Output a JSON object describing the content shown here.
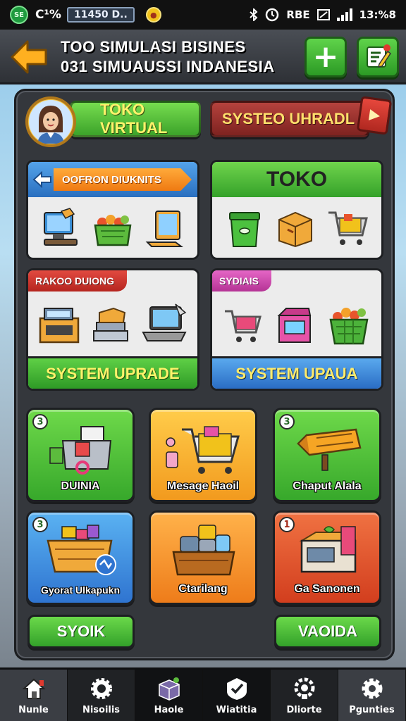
{
  "status_bar": {
    "left_text": "C¹%",
    "pill_text": "11450 D..",
    "logo_text": "SE",
    "right_label": "RBE",
    "time": "13:%8"
  },
  "header": {
    "line1": "TOO SIMULASI BISINES",
    "line2": "031 SIMUAUSSI INDANESIA",
    "add_label": "+",
    "back_icon": "arrow-left-icon",
    "edit_icon": "edit-list-icon"
  },
  "top_buttons": {
    "toko_virtual": "TOKO VIRTUAL",
    "system_label": "SYSTEO UHRADL"
  },
  "cards": {
    "left_top": {
      "tag": "OOFRON DIUKNITS"
    },
    "right_top": {
      "title": "TOKO"
    },
    "left_mid": {
      "tag": "RAKOO DUIONG",
      "footer": "SYSTEM UPRADE"
    },
    "right_mid": {
      "tag": "SYDIAIS",
      "footer": "SYSTEM UPAUA"
    }
  },
  "tiles": [
    {
      "badge": "3",
      "label": "DUINIA"
    },
    {
      "badge": "",
      "label": "Mesage Haoil"
    },
    {
      "badge": "3",
      "label": "Chaput Alala"
    },
    {
      "badge": "3",
      "label": "Gyorat Ulkapukn"
    },
    {
      "badge": "",
      "label": "Ctarilang"
    },
    {
      "badge": "1",
      "label": "Ga Sanonen"
    }
  ],
  "bottom_buttons": {
    "left": "SYOIK",
    "right": "VAOIDA"
  },
  "nav": [
    {
      "label": "Nunle",
      "icon": "home-icon"
    },
    {
      "label": "Nisoilis",
      "icon": "gear-icon"
    },
    {
      "label": "Haole",
      "icon": "box-icon"
    },
    {
      "label": "Wiatitia",
      "icon": "check-badge-icon"
    },
    {
      "label": "Dliorte",
      "icon": "cog-lock-icon"
    },
    {
      "label": "Pgunties",
      "icon": "settings-icon"
    }
  ],
  "colors": {
    "green": "#3ca32a",
    "orange": "#f29a1e",
    "blue": "#2f74d0",
    "red": "#d23e1e",
    "panel": "#34373c"
  }
}
